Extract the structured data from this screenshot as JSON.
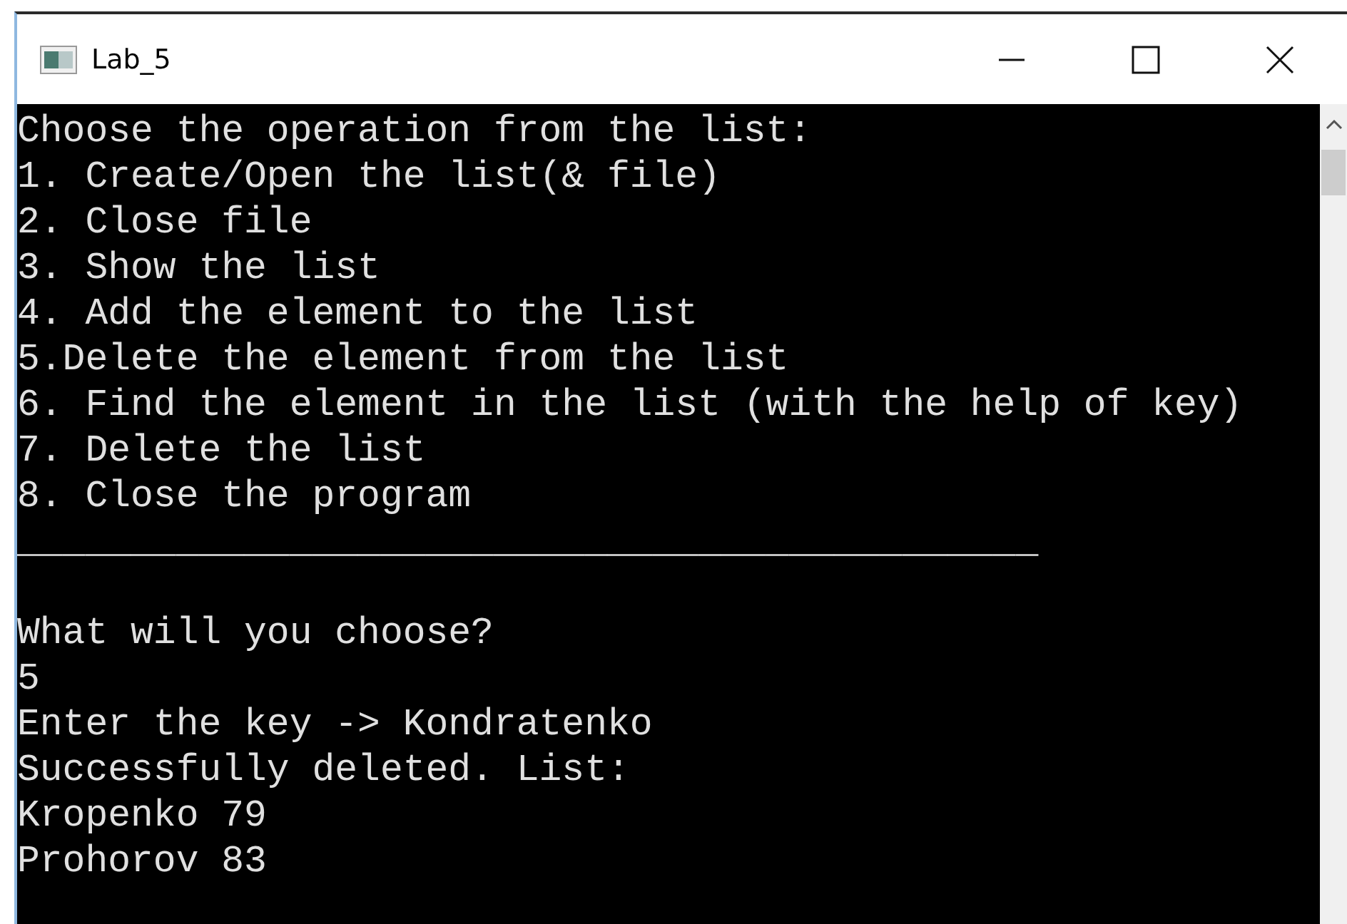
{
  "window": {
    "title": "Lab_5"
  },
  "console": {
    "menu": [
      "Choose the operation from the list:",
      "1. Create/Open the list(& file)",
      "2. Close file",
      "3. Show the list",
      "4. Add the element to the list",
      "5.Delete the element from the list",
      "6. Find the element in the list (with the help of key)",
      "7. Delete the list",
      "8. Close the program"
    ],
    "separator": "_____________________________________________",
    "session": [
      "What will you choose?",
      "5",
      "Enter the key -> Kondratenko",
      "Successfully deleted. List:",
      "Kropenko 79",
      "Prohorov 83"
    ]
  }
}
